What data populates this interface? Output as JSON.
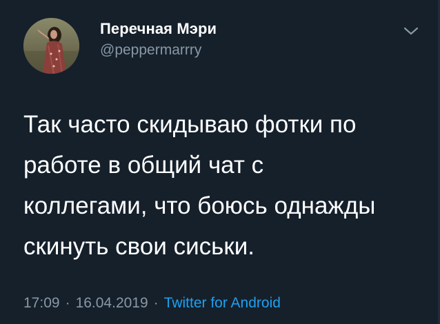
{
  "author": {
    "display_name": "Перечная Мэри",
    "handle": "@peppermarrry",
    "avatar_icon": "profile-photo"
  },
  "tweet": {
    "text_lines": [
      "Так часто скидываю фотки по",
      "работе в общий чат с",
      "коллегами, что боюсь однажды",
      "скинуть свои сиськи."
    ]
  },
  "meta": {
    "time": "17:09",
    "separator": "·",
    "date": "16.04.2019",
    "source": "Twitter for Android"
  },
  "menu": {
    "icon": "chevron-down-icon"
  },
  "colors": {
    "background": "#15202b",
    "primary_text": "#ffffff",
    "secondary_text": "#8899a6",
    "link": "#1da1f2"
  }
}
